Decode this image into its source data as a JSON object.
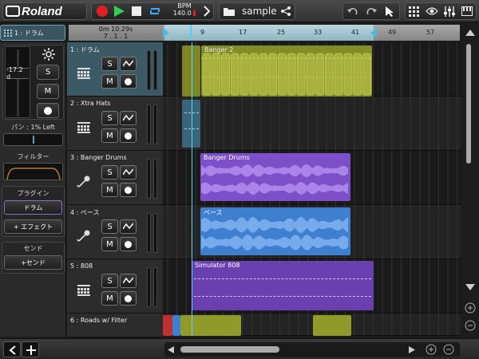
{
  "app": {
    "logo": "Roland",
    "song_name": "sample"
  },
  "transport": {
    "bpm_label": "BPM",
    "bpm_value": "140.0",
    "time_top": "0m 10.29s",
    "time_bottom": "7 . 1 . 1"
  },
  "ruler": {
    "marks": [
      "9",
      "17",
      "25",
      "33",
      "41",
      "49",
      "57"
    ]
  },
  "inspector": {
    "selected_track": "1 : ドラム",
    "volume_value": "-17.2 d",
    "solo": "S",
    "mute": "M",
    "pan_label": "パン : 1% Left",
    "filter_label": "フィルター",
    "plugin_label": "プラグイン",
    "plugin_item": "ドラム",
    "add_effect": "+ エフェクト",
    "send_label": "センド",
    "add_send": "+センド"
  },
  "tracks": [
    {
      "name": "1 : ドラム",
      "icon": "drum-grid-icon",
      "selected": true
    },
    {
      "name": "2 : Xtra Hats",
      "icon": "drum-grid-icon",
      "selected": false
    },
    {
      "name": "3 : Banger Drums",
      "icon": "microphone-icon",
      "selected": false
    },
    {
      "name": "4 : ベース",
      "icon": "microphone-icon",
      "selected": false
    },
    {
      "name": "5 : 808",
      "icon": "drum-grid-icon",
      "selected": false
    },
    {
      "name": "6 : Roads w/ Filter",
      "icon": "keyboard-icon",
      "selected": false
    }
  ],
  "clips": {
    "banger2": "Banger 2",
    "banger_drums": "Banger Drums",
    "bass": "ベース",
    "simulator": "Simulator 808"
  },
  "buttons": {
    "solo": "S",
    "mute": "M"
  },
  "colors": {
    "accent": "#4fa3c0",
    "drum_clip": "#8f9a2a",
    "audio_purple": "#7d4fc8",
    "audio_blue": "#3f7fd0",
    "synth_purple": "#6a3fb0",
    "record": "#e02020",
    "play": "#33cc55"
  }
}
